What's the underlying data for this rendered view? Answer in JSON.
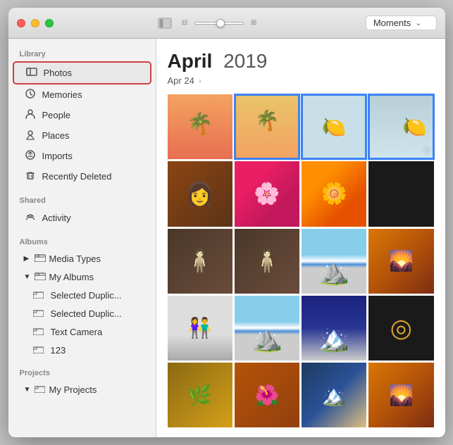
{
  "window": {
    "title": "Photos"
  },
  "titlebar": {
    "traffic": {
      "close": "close",
      "minimize": "minimize",
      "maximize": "maximize"
    },
    "sidebar_toggle": "☰",
    "thumbnail_small": "⊞",
    "thumbnail_large": "⊟",
    "dropdown_label": "Moments"
  },
  "sidebar": {
    "sections": [
      {
        "name": "Library",
        "items": [
          {
            "id": "photos",
            "label": "Photos",
            "icon": "▣",
            "active": true
          },
          {
            "id": "memories",
            "label": "Memories",
            "icon": "⟳"
          },
          {
            "id": "people",
            "label": "People",
            "icon": "👤"
          },
          {
            "id": "places",
            "label": "Places",
            "icon": "📍"
          },
          {
            "id": "imports",
            "label": "Imports",
            "icon": "⏱"
          },
          {
            "id": "recently-deleted",
            "label": "Recently Deleted",
            "icon": "🗑"
          }
        ]
      },
      {
        "name": "Shared",
        "items": [
          {
            "id": "activity",
            "label": "Activity",
            "icon": "☁"
          }
        ]
      },
      {
        "name": "Albums",
        "items": [
          {
            "id": "media-types",
            "label": "Media Types",
            "icon": "▣",
            "collapsed": true
          },
          {
            "id": "my-albums",
            "label": "My Albums",
            "icon": "▣",
            "expanded": true
          },
          {
            "id": "selected-1",
            "label": "Selected Duplic...",
            "icon": "▣",
            "indented": true
          },
          {
            "id": "selected-2",
            "label": "Selected Duplic...",
            "icon": "▣",
            "indented": true
          },
          {
            "id": "text-camera",
            "label": "Text Camera",
            "icon": "▣",
            "indented": true
          },
          {
            "id": "123",
            "label": "123",
            "icon": "▣",
            "indented": true
          }
        ]
      },
      {
        "name": "Projects",
        "items": [
          {
            "id": "my-projects",
            "label": "My Projects",
            "icon": "▣",
            "expanded": true
          }
        ]
      }
    ]
  },
  "photo_area": {
    "month": "April",
    "year": "2019",
    "date_label": "Apr 24",
    "photos": [
      {
        "id": 1,
        "style": "palm",
        "selected": false
      },
      {
        "id": 2,
        "style": "palm2",
        "selected": true
      },
      {
        "id": 3,
        "style": "lemons",
        "selected": true
      },
      {
        "id": 4,
        "style": "lemons4",
        "selected": true,
        "partial": true
      },
      {
        "id": 5,
        "style": "woman",
        "selected": false
      },
      {
        "id": 6,
        "style": "flowers1",
        "selected": false
      },
      {
        "id": 7,
        "style": "flowers2",
        "selected": false
      },
      {
        "id": 8,
        "style": "dark",
        "selected": false
      },
      {
        "id": 9,
        "style": "tatoo",
        "selected": false
      },
      {
        "id": 10,
        "style": "tatoo",
        "selected": false
      },
      {
        "id": 11,
        "style": "mountain",
        "selected": false
      },
      {
        "id": 12,
        "style": "sunset",
        "selected": false
      },
      {
        "id": 13,
        "style": "couple",
        "selected": false
      },
      {
        "id": 14,
        "style": "mountain2",
        "selected": false
      },
      {
        "id": 15,
        "style": "mountain-dark",
        "selected": false
      },
      {
        "id": 16,
        "style": "circle",
        "selected": false
      },
      {
        "id": 17,
        "style": "row5-1",
        "selected": false
      },
      {
        "id": 18,
        "style": "row5-2",
        "selected": false
      },
      {
        "id": 19,
        "style": "row5-3",
        "selected": false
      },
      {
        "id": 20,
        "style": "row5-4",
        "selected": false
      }
    ]
  }
}
